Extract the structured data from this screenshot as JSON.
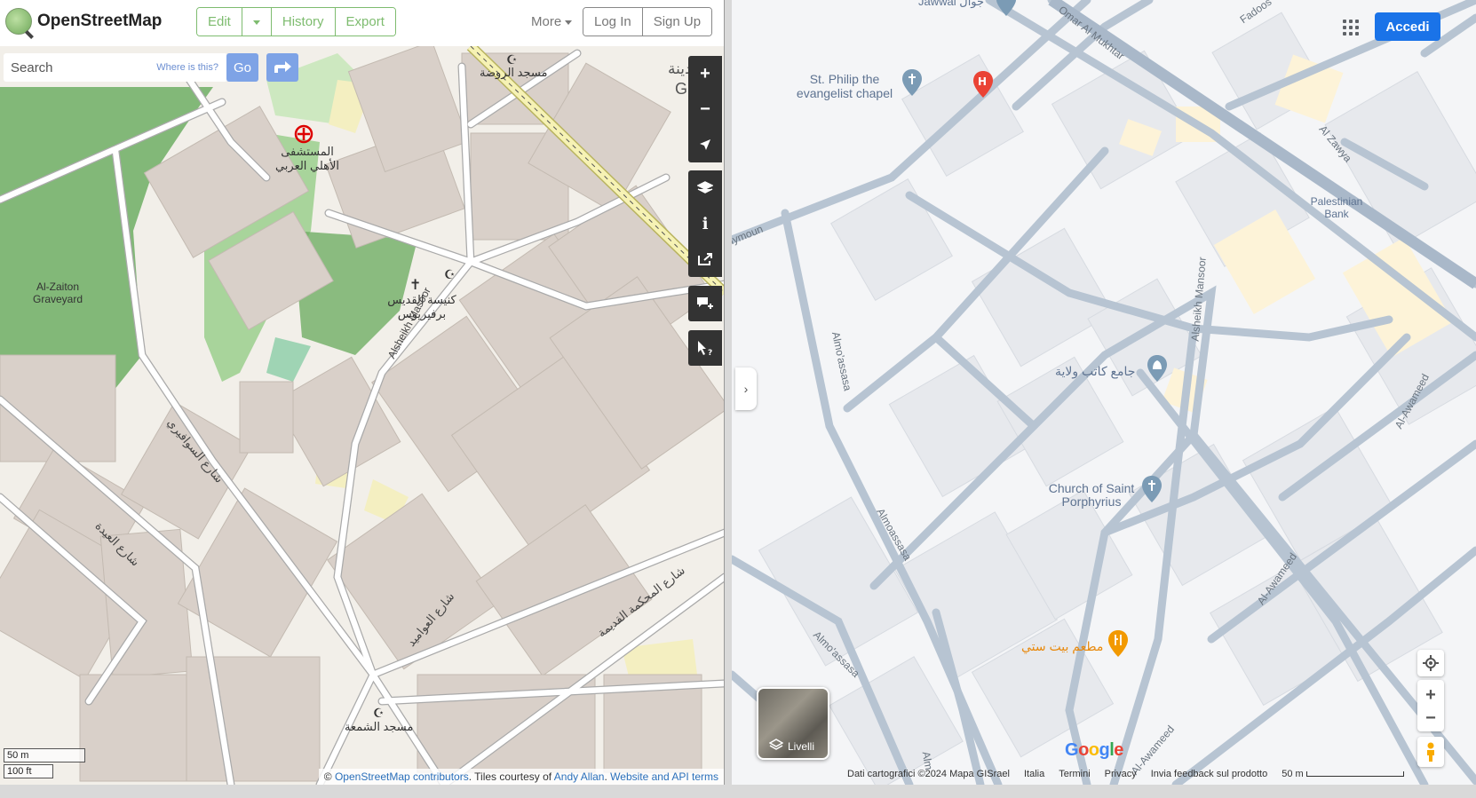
{
  "osm": {
    "brand": "OpenStreetMap",
    "nav": {
      "edit": "Edit",
      "history": "History",
      "export": "Export",
      "more": "More"
    },
    "auth": {
      "login": "Log In",
      "signup": "Sign Up"
    },
    "search": {
      "placeholder": "Search",
      "where": "Where is this?",
      "go": "Go"
    },
    "controls": {
      "zoom_in": "+",
      "zoom_out": "−"
    },
    "labels": {
      "hospital": "المستشفى الأهلي العربي",
      "mosque_rawda": "مسجد الروضة",
      "gaza": "Gaza",
      "gaza_ar": "مدينة",
      "church": "كنيسة القديس برفيريوس",
      "graveyard": "Al-Zaiton Graveyard",
      "alsheikh": "Alsheikh Masoor",
      "sawafiri": "شارع السوافيري",
      "aida": "شارع العيدة",
      "awamid": "شارع العواميد",
      "mahkama": "شارع المحكمة القديمة",
      "shamaa": "مسجد الشمعة"
    },
    "scale": {
      "m": "50 m",
      "ft": "100 ft"
    },
    "attribution": {
      "prefix": "© ",
      "contributors": "OpenStreetMap contributors",
      "tiles": ". Tiles courtesy of ",
      "andy": "Andy Allan",
      "sep": ". ",
      "terms": "Website and API terms"
    }
  },
  "google": {
    "signin": "Accedi",
    "layers": "Livelli",
    "logo": "Google",
    "attribution": {
      "data": "Dati cartografici ©2024 Mapa GISrael",
      "country": "Italia",
      "terms": "Termini",
      "privacy": "Privacy",
      "feedback": "Invia feedback sul prodotto",
      "scale": "50 m"
    },
    "places": {
      "chapel": "St. Philip the evangelist chapel",
      "mosque": "جامع كاتب ولاية",
      "church": "Church of Saint Porphyrius",
      "restaurant": "مطعم بيت ستي",
      "bank": "Palestinian Bank",
      "jawwal": "Jawwal جوال"
    },
    "streets": {
      "omar": "Omar Al Mukhtar",
      "zawya": "Al Zawya",
      "fadous": "Fadoos",
      "mansoor": "Alsheikh Mansoor",
      "moassasa": "Almo'assasa",
      "moassasa2": "Almoassasa",
      "moassasa3": "Almo'assasa",
      "awameed1": "Al-Awameed",
      "awameed2": "Al-Awameed",
      "awameed3": "Al-Awameed",
      "ilymoun": "Ilymoun",
      "alm": "Alm"
    }
  },
  "colors": {
    "osm_bg": "#f2efe9",
    "osm_green": "#7ebc6f",
    "building": "#d9d0c9",
    "google_bg": "#f4f5f7",
    "google_road": "#b7c4d2",
    "google_blue": "#1a73e8"
  }
}
